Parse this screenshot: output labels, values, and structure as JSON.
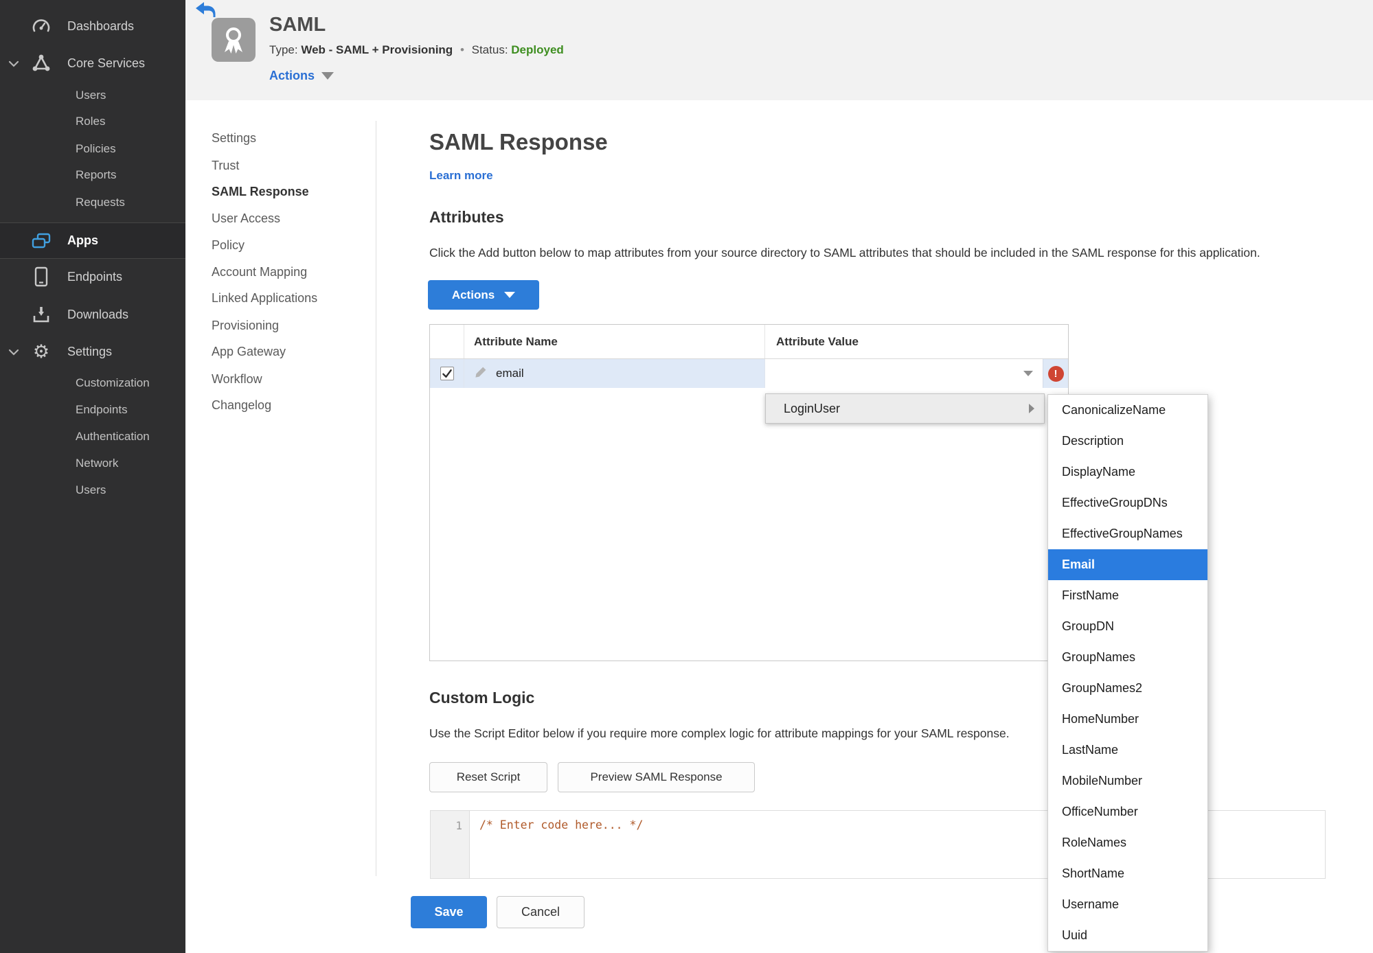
{
  "colors": {
    "accent_blue": "#2d7dd9",
    "link_blue": "#2a6fd4",
    "status_green": "#3e8e20",
    "error_red": "#cf4533",
    "selected_menu_blue": "#2a7cdf",
    "row_highlight": "#dfe9f7",
    "code_orange": "#b05a2a",
    "sidebar_bg": "#2f2f30"
  },
  "sidebar": {
    "items": [
      {
        "label": "Dashboards"
      },
      {
        "label": "Core Services",
        "children": [
          "Users",
          "Roles",
          "Policies",
          "Reports",
          "Requests"
        ]
      },
      {
        "label": "Apps"
      },
      {
        "label": "Endpoints"
      },
      {
        "label": "Downloads"
      },
      {
        "label": "Settings",
        "children": [
          "Customization",
          "Endpoints",
          "Authentication",
          "Network",
          "Users"
        ]
      }
    ]
  },
  "header": {
    "title": "SAML",
    "type_label": "Type:",
    "type_value": "Web - SAML + Provisioning",
    "separator": "•",
    "status_label": "Status:",
    "status_value": "Deployed",
    "actions_label": "Actions"
  },
  "subnav": {
    "items": [
      "Settings",
      "Trust",
      "SAML Response",
      "User Access",
      "Policy",
      "Account Mapping",
      "Linked Applications",
      "Provisioning",
      "App Gateway",
      "Workflow",
      "Changelog"
    ],
    "active": "SAML Response"
  },
  "main": {
    "title": "SAML Response",
    "learn_more": "Learn more",
    "attributes": {
      "heading": "Attributes",
      "description": "Click the Add button below to map attributes from your source directory to SAML attributes that should be included in the SAML response for this application.",
      "actions_button": "Actions",
      "table": {
        "col_name": "Attribute Name",
        "col_value": "Attribute Value",
        "row": {
          "name": "email",
          "value": "",
          "error": true
        }
      }
    },
    "value_menu": {
      "parent": "LoginUser",
      "selected": "Email",
      "items": [
        "CanonicalizeName",
        "Description",
        "DisplayName",
        "EffectiveGroupDNs",
        "EffectiveGroupNames",
        "Email",
        "FirstName",
        "GroupDN",
        "GroupNames",
        "GroupNames2",
        "HomeNumber",
        "LastName",
        "MobileNumber",
        "OfficeNumber",
        "RoleNames",
        "ShortName",
        "Username",
        "Uuid"
      ]
    },
    "custom_logic": {
      "heading": "Custom Logic",
      "description": "Use the Script Editor below if you require more complex logic for attribute mappings for your SAML response.",
      "reset_button": "Reset Script",
      "preview_button": "Preview SAML Response",
      "editor": {
        "line_number": "1",
        "code": "/* Enter code here... */"
      }
    },
    "footer": {
      "save": "Save",
      "cancel": "Cancel"
    }
  }
}
